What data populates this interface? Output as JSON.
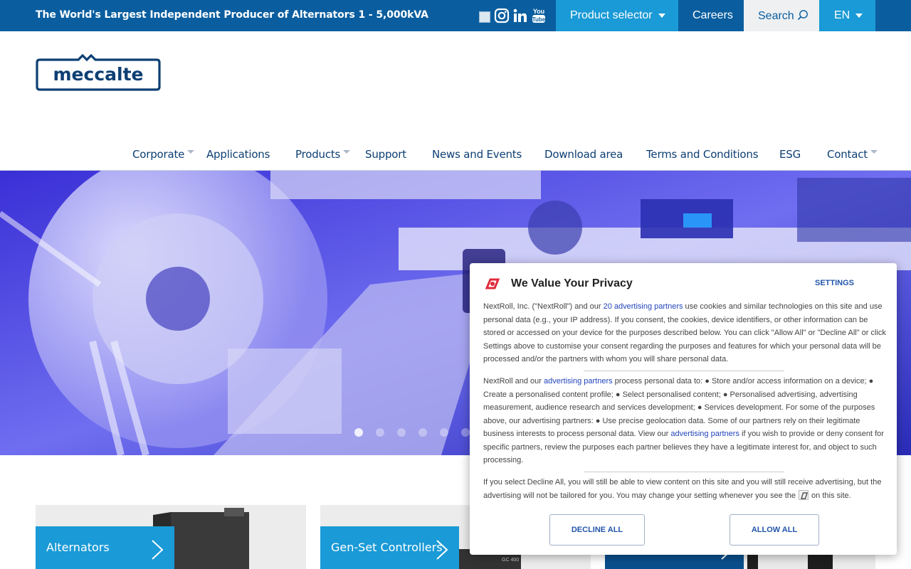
{
  "topbar": {
    "tagline": "The World's Largest Independent Producer of Alternators 1 - 5,000kVA",
    "social_icons": [
      "broken-image-icon",
      "instagram-icon",
      "linkedin-icon",
      "youtube-icon"
    ],
    "product_selector": "Product selector",
    "careers": "Careers",
    "search": "Search",
    "language": "EN"
  },
  "logo": {
    "text": "meccalte"
  },
  "nav": {
    "items": [
      "Corporate",
      "Applications",
      "Products",
      "Support",
      "News and Events",
      "Download area",
      "Terms and Conditions",
      "ESG",
      "Contact"
    ]
  },
  "hero": {
    "slides": 6,
    "active_slide": 1
  },
  "cards": [
    {
      "label": "Alternators"
    },
    {
      "label": "Gen-Set Controllers"
    },
    {
      "label": ""
    }
  ],
  "privacy": {
    "title": "We Value Your Privacy",
    "settings": "SETTINGS",
    "p1_a": "NextRoll, Inc. (\"NextRoll\") and our ",
    "p1_link": "20 advertising partners",
    "p1_b": " use cookies and similar technologies on this site and use personal data (e.g., your IP address). If you consent, the cookies, device identifiers, or other information can be stored or accessed on your device for the purposes described below. You can click \"Allow All\" or \"Decline All\" or click Settings above to customise your consent regarding the purposes and features for which your personal data will be processed and/or the partners with whom you will share personal data.",
    "p2_a": "NextRoll and our ",
    "p2_link": "advertising partners",
    "p2_b": " process personal data to: ● Store and/or access information on a device; ● Create a personalised content profile; ● Select personalised content; ● Personalised advertising, advertising measurement, audience research and services development; ● Services development. For some of the purposes above, our advertising partners: ● Use precise geolocation data. Some of our partners rely on their legitimate business interests to process personal data. View our ",
    "p2_link2": "advertising partners",
    "p2_c": " if you wish to provide or deny consent for specific partners, review the purposes each partner believes they have a legitimate interest for, and object to such processing.",
    "p3_a": "If you select Decline All, you will still be able to view content on this site and you will still receive advertising, but the advertising will not be tailored for you. You may change your setting whenever you see the",
    "p3_b": "on this site.",
    "decline": "DECLINE ALL",
    "allow": "ALLOW ALL"
  },
  "colors": {
    "primary": "#0a5e9f",
    "accent": "#1a9ad6",
    "nav_text": "#0d3f73",
    "link": "#2244bb"
  }
}
